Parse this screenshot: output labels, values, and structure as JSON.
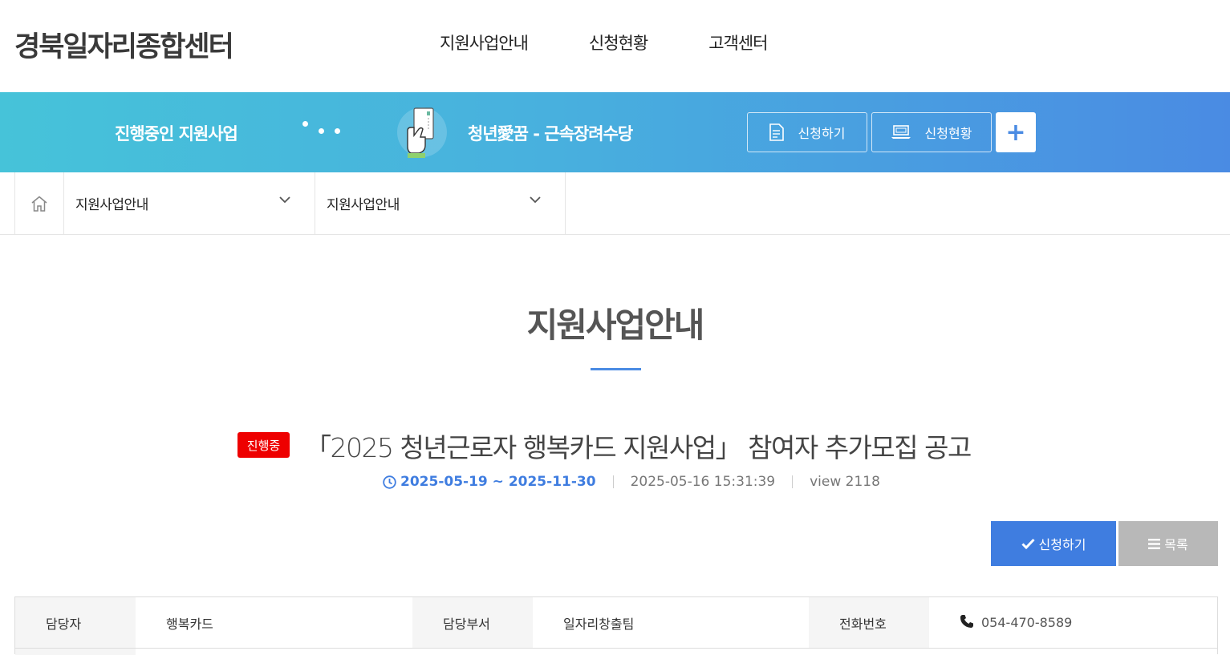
{
  "header": {
    "logo": "경북일자리종합센터",
    "nav": [
      "지원사업안내",
      "신청현황",
      "고객센터"
    ]
  },
  "banner": {
    "title": "진행중인 지원사업",
    "program": "청년愛꿈 - 근속장려수당",
    "apply_label": "신청하기",
    "status_label": "신청현황",
    "plus_label": "+"
  },
  "breadcrumb": {
    "level1": "지원사업안내",
    "level2": "지원사업안내"
  },
  "page": {
    "title": "지원사업안내"
  },
  "post": {
    "badge": "진행중",
    "title": "「2025 청년근로자 행복카드 지원사업」 참여자 추가모집 공고",
    "period": "2025-05-19 ~ 2025-11-30",
    "date": "2025-05-16 15:31:39",
    "views": "view 2118"
  },
  "actions": {
    "apply": "신청하기",
    "list": "목록"
  },
  "info": {
    "manager_label": "담당자",
    "manager_value": "행복카드",
    "dept_label": "담당부서",
    "dept_value": "일자리창출팀",
    "phone_label": "전화번호",
    "phone_value": "054-470-8589"
  },
  "colors": {
    "accent": "#3f7de0",
    "badge": "#ee0000",
    "banner_start": "#46c3d9",
    "banner_end": "#4a8be3"
  }
}
